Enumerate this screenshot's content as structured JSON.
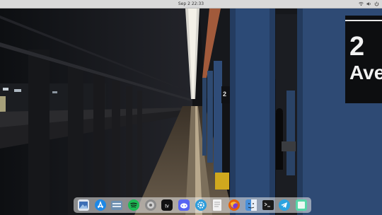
{
  "topbar": {
    "clock": "Sep 2 22:33"
  },
  "wallpaper": {
    "sign_number": "2",
    "sign_text": "Ave",
    "small_sign": "2"
  },
  "dock": {
    "items": [
      {
        "icon": "preview-icon",
        "color": "#3d6fb6"
      },
      {
        "icon": "app-store-icon",
        "color": "#1e88e5"
      },
      {
        "icon": "finder-files-icon",
        "color": "#6d8fb0"
      },
      {
        "icon": "spotify-icon",
        "color": "#1db954"
      },
      {
        "icon": "system-preferences-icon",
        "color": "#8a8a8a"
      },
      {
        "icon": "apple-tv-icon",
        "color": "#111111"
      },
      {
        "icon": "discord-icon",
        "color": "#5865f2"
      },
      {
        "icon": "settings-gear-icon",
        "color": "#2d9cdb"
      },
      {
        "icon": "textedit-icon",
        "color": "#f2f2f2"
      },
      {
        "icon": "firefox-icon",
        "color": "#e66000"
      },
      {
        "icon": "finder-icon",
        "color": "#4a90d9"
      },
      {
        "icon": "terminal-icon",
        "color": "#1a1a1a"
      },
      {
        "icon": "telegram-icon",
        "color": "#2aa3e0"
      },
      {
        "icon": "notes-icon",
        "color": "#56d5a8"
      }
    ]
  }
}
